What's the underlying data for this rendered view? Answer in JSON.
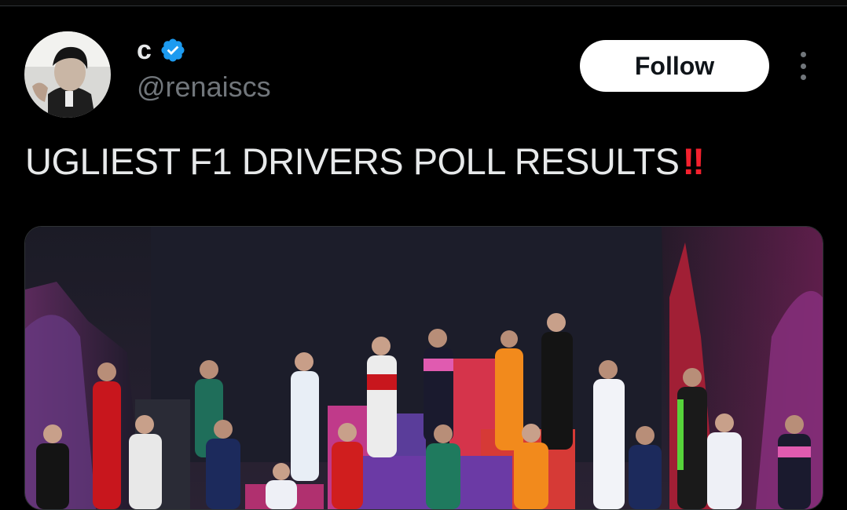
{
  "author": {
    "display_name": "c",
    "handle": "@renaiscs",
    "verified": true,
    "verified_color": "#1d9bf0"
  },
  "actions": {
    "follow_label": "Follow",
    "more_icon": "more-vertical-icon"
  },
  "tweet": {
    "text": "UGLIEST F1 DRIVERS POLL RESULTS",
    "emoji": "‼"
  },
  "media": {
    "type": "photo"
  },
  "colors": {
    "background": "#000000",
    "text": "#e7e9ea",
    "secondary_text": "#71767b",
    "follow_button_bg": "#ffffff",
    "follow_button_text": "#0f1419",
    "emoji_red": "#f4212e"
  }
}
